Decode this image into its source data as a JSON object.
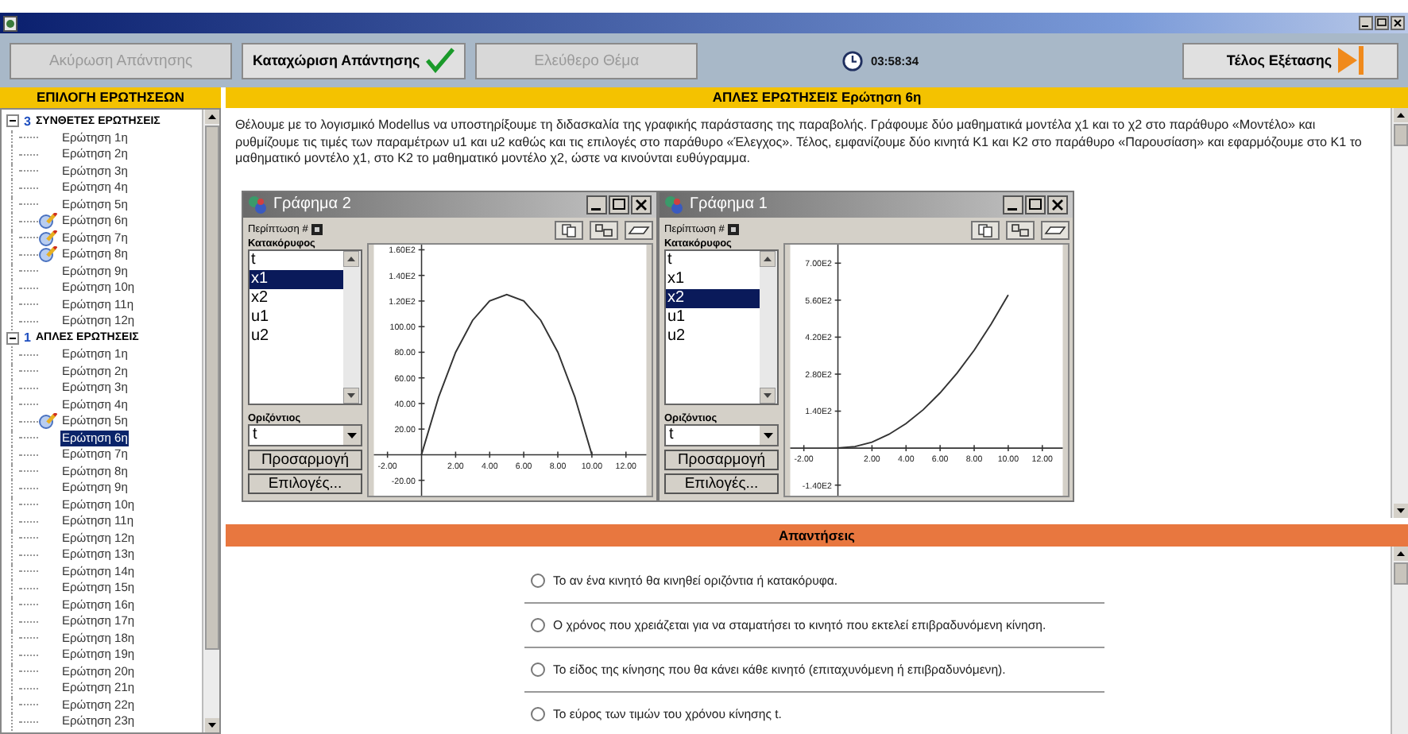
{
  "toolbar": {
    "buttons": [
      {
        "label": "Ακύρωση Απάντησης",
        "disabled": true,
        "kind": "plain"
      },
      {
        "label": "Καταχώριση Απάντησης",
        "disabled": false,
        "kind": "submit"
      },
      {
        "label": "Ελεύθερο Θέμα",
        "disabled": true,
        "kind": "plain"
      }
    ],
    "timer": "03:58:34",
    "finish_button": "Τέλος Εξέτασης"
  },
  "sidebar": {
    "title": "ΕΠΙΛΟΓΗ ΕΡΩΤΗΣΕΩΝ",
    "groups": [
      {
        "count": "3",
        "label": "ΣΥΝΘΕΤΕΣ ΕΡΩΤΗΣΕΙΣ",
        "expanded": true,
        "children": [
          {
            "label": "Ερώτηση 1η",
            "answered": false,
            "selected": false
          },
          {
            "label": "Ερώτηση 2η",
            "answered": false,
            "selected": false
          },
          {
            "label": "Ερώτηση 3η",
            "answered": false,
            "selected": false
          },
          {
            "label": "Ερώτηση 4η",
            "answered": false,
            "selected": false
          },
          {
            "label": "Ερώτηση 5η",
            "answered": false,
            "selected": false
          },
          {
            "label": "Ερώτηση 6η",
            "answered": true,
            "selected": false
          },
          {
            "label": "Ερώτηση 7η",
            "answered": true,
            "selected": false
          },
          {
            "label": "Ερώτηση 8η",
            "answered": true,
            "selected": false
          },
          {
            "label": "Ερώτηση 9η",
            "answered": false,
            "selected": false
          },
          {
            "label": "Ερώτηση 10η",
            "answered": false,
            "selected": false
          },
          {
            "label": "Ερώτηση 11η",
            "answered": false,
            "selected": false
          },
          {
            "label": "Ερώτηση 12η",
            "answered": false,
            "selected": false
          }
        ]
      },
      {
        "count": "1",
        "label": "ΑΠΛΕΣ ΕΡΩΤΗΣΕΙΣ",
        "expanded": true,
        "children": [
          {
            "label": "Ερώτηση 1η",
            "answered": false,
            "selected": false
          },
          {
            "label": "Ερώτηση 2η",
            "answered": false,
            "selected": false
          },
          {
            "label": "Ερώτηση 3η",
            "answered": false,
            "selected": false
          },
          {
            "label": "Ερώτηση 4η",
            "answered": false,
            "selected": false
          },
          {
            "label": "Ερώτηση 5η",
            "answered": true,
            "selected": false
          },
          {
            "label": "Ερώτηση 6η",
            "answered": false,
            "selected": true
          },
          {
            "label": "Ερώτηση 7η",
            "answered": false,
            "selected": false
          },
          {
            "label": "Ερώτηση 8η",
            "answered": false,
            "selected": false
          },
          {
            "label": "Ερώτηση 9η",
            "answered": false,
            "selected": false
          },
          {
            "label": "Ερώτηση 10η",
            "answered": false,
            "selected": false
          },
          {
            "label": "Ερώτηση 11η",
            "answered": false,
            "selected": false
          },
          {
            "label": "Ερώτηση 12η",
            "answered": false,
            "selected": false
          },
          {
            "label": "Ερώτηση 13η",
            "answered": false,
            "selected": false
          },
          {
            "label": "Ερώτηση 14η",
            "answered": false,
            "selected": false
          },
          {
            "label": "Ερώτηση 15η",
            "answered": false,
            "selected": false
          },
          {
            "label": "Ερώτηση 16η",
            "answered": false,
            "selected": false
          },
          {
            "label": "Ερώτηση 17η",
            "answered": false,
            "selected": false
          },
          {
            "label": "Ερώτηση 18η",
            "answered": false,
            "selected": false
          },
          {
            "label": "Ερώτηση 19η",
            "answered": false,
            "selected": false
          },
          {
            "label": "Ερώτηση 20η",
            "answered": false,
            "selected": false
          },
          {
            "label": "Ερώτηση 21η",
            "answered": false,
            "selected": false
          },
          {
            "label": "Ερώτηση 22η",
            "answered": false,
            "selected": false
          },
          {
            "label": "Ερώτηση 23η",
            "answered": false,
            "selected": false
          }
        ]
      }
    ]
  },
  "question": {
    "title": "ΑΠΛΕΣ ΕΡΩΤΗΣΕΙΣ Ερώτηση 6η",
    "text": "Θέλουμε με το λογισμικό Modellus να υποστηρίξουμε τη διδασκαλία της γραφικής παράστασης της παραβολής. Γράφουμε δύο μαθηματικά μοντέλα χ1 και το χ2 στο παράθυρο «Μοντέλο» και ρυθμίζουμε τις τιμές των παραμέτρων u1 και u2 καθώς και τις επιλογές στο παράθυρο «Έλεγχος». Τέλος, εμφανίζουμε δύο κινητά Κ1 και Κ2 στο παράθυρο «Παρουσίαση» και εφαρμόζουμε στο Κ1 το μαθηματικό μοντέλο χ1, στο Κ2 το μαθηματικό μοντέλο χ2, ώστε να κινούνται ευθύγραμμα.",
    "graphs": [
      {
        "title": "Γράφημα 2",
        "case_label": "Περίπτωση #",
        "vertical_label": "Κατακόρυφος",
        "variables": [
          {
            "label": "t",
            "selected": false
          },
          {
            "label": "x1",
            "selected": true
          },
          {
            "label": "x2",
            "selected": false
          },
          {
            "label": "u1",
            "selected": false
          },
          {
            "label": "u2",
            "selected": false
          }
        ],
        "horizontal_label": "Οριζόντιος",
        "horizontal_value": "t",
        "fit_button": "Προσαρμογή",
        "options_button": "Επιλογές...",
        "chart_data": {
          "type": "line",
          "x": [
            0,
            1,
            2,
            3,
            4,
            5,
            6,
            7,
            8,
            9,
            10
          ],
          "series": [
            {
              "color": "#333333",
              "values": [
                0,
                45,
                80,
                105,
                120,
                125,
                120,
                105,
                80,
                45,
                0
              ]
            }
          ],
          "xlim": [
            -2.8,
            13.2
          ],
          "ylim": [
            -32,
            164
          ],
          "xticks": [
            {
              "value": -2,
              "label": "-2.00"
            },
            {
              "value": 2,
              "label": "2.00"
            },
            {
              "value": 4,
              "label": "4.00"
            },
            {
              "value": 6,
              "label": "6.00"
            },
            {
              "value": 8,
              "label": "8.00"
            },
            {
              "value": 10,
              "label": "10.00"
            },
            {
              "value": 12,
              "label": "12.00"
            }
          ],
          "yticks": [
            {
              "value": -20,
              "label": "-20.00"
            },
            {
              "value": 20,
              "label": "20.00"
            },
            {
              "value": 40,
              "label": "40.00"
            },
            {
              "value": 60,
              "label": "60.00"
            },
            {
              "value": 80,
              "label": "80.00"
            },
            {
              "value": 100,
              "label": "100.00"
            },
            {
              "value": 120,
              "label": "1.20E2"
            },
            {
              "value": 140,
              "label": "1.40E2"
            },
            {
              "value": 160,
              "label": "1.60E2"
            }
          ]
        }
      },
      {
        "title": "Γράφημα 1",
        "case_label": "Περίπτωση #",
        "vertical_label": "Κατακόρυφος",
        "variables": [
          {
            "label": "t",
            "selected": false
          },
          {
            "label": "x1",
            "selected": false
          },
          {
            "label": "x2",
            "selected": true
          },
          {
            "label": "u1",
            "selected": false
          },
          {
            "label": "u2",
            "selected": false
          }
        ],
        "horizontal_label": "Οριζόντιος",
        "horizontal_value": "t",
        "fit_button": "Προσαρμογή",
        "options_button": "Επιλογές...",
        "chart_data": {
          "type": "line",
          "x": [
            0,
            1,
            2,
            3,
            4,
            5,
            6,
            7,
            8,
            9,
            10
          ],
          "series": [
            {
              "color": "#333333",
              "values": [
                0,
                6,
                23,
                52,
                93,
                145,
                209,
                284,
                371,
                470,
                580
              ]
            }
          ],
          "xlim": [
            -2.8,
            13.2
          ],
          "ylim": [
            -180,
            770
          ],
          "xticks": [
            {
              "value": -2,
              "label": "-2.00"
            },
            {
              "value": 2,
              "label": "2.00"
            },
            {
              "value": 4,
              "label": "4.00"
            },
            {
              "value": 6,
              "label": "6.00"
            },
            {
              "value": 8,
              "label": "8.00"
            },
            {
              "value": 10,
              "label": "10.00"
            },
            {
              "value": 12,
              "label": "12.00"
            }
          ],
          "yticks": [
            {
              "value": -140,
              "label": "-1.40E2"
            },
            {
              "value": 140,
              "label": "1.40E2"
            },
            {
              "value": 280,
              "label": "2.80E2"
            },
            {
              "value": 420,
              "label": "4.20E2"
            },
            {
              "value": 560,
              "label": "5.60E2"
            },
            {
              "value": 700,
              "label": "7.00E2"
            }
          ]
        }
      }
    ]
  },
  "answers": {
    "title": "Απαντήσεις",
    "options": [
      {
        "label": "Το αν ένα κινητό θα κινηθεί οριζόντια ή κατακόρυφα.",
        "selected": false
      },
      {
        "label": "Ο χρόνος που χρειάζεται για να σταματήσει το κινητό που εκτελεί επιβραδυνόμενη κίνηση.",
        "selected": false
      },
      {
        "label": "Το είδος της κίνησης που θα κάνει κάθε κινητό (επιταχυνόμενη ή επιβραδυνόμενη).",
        "selected": false
      },
      {
        "label": "Το εύρος των τιμών του χρόνου κίνησης t.",
        "selected": false
      }
    ]
  }
}
